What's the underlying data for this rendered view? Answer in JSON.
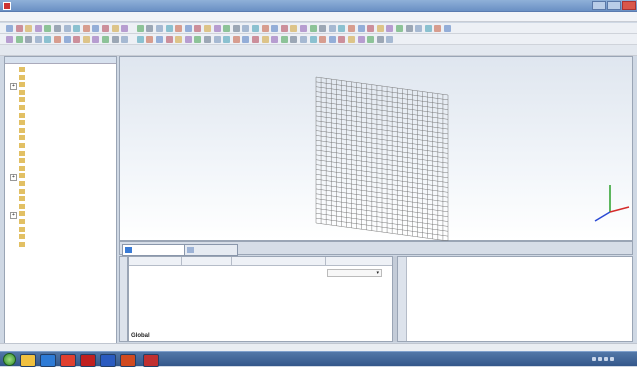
{
  "colors": {
    "window_frame": "#6a90c4",
    "viewport_top": "#dfe6ef",
    "mesh": "#6c6c6c",
    "folder": "#e2c064",
    "axis_x": "#d42a2a",
    "axis_y": "#2aa02a",
    "axis_z": "#2a4ad4",
    "taskbar": "#33578a"
  },
  "param_columns": [],
  "messages_label": "",
  "param_global": "Global",
  "axis": {
    "x": "",
    "y": "",
    "z": ""
  },
  "taskbar": {
    "start_icon": "windows-orb-icon",
    "apps": [
      "windows-explorer-icon",
      "cst-icon",
      "chrome-icon",
      "acrobat-icon",
      "word-icon",
      "powerpoint-icon",
      "cst-window-icon"
    ]
  },
  "icons": {
    "tree_folder": "folder-icon",
    "tree_toggle": "expand-icon",
    "window_controls": [
      "minimize-icon",
      "maximize-icon",
      "close-icon"
    ]
  }
}
